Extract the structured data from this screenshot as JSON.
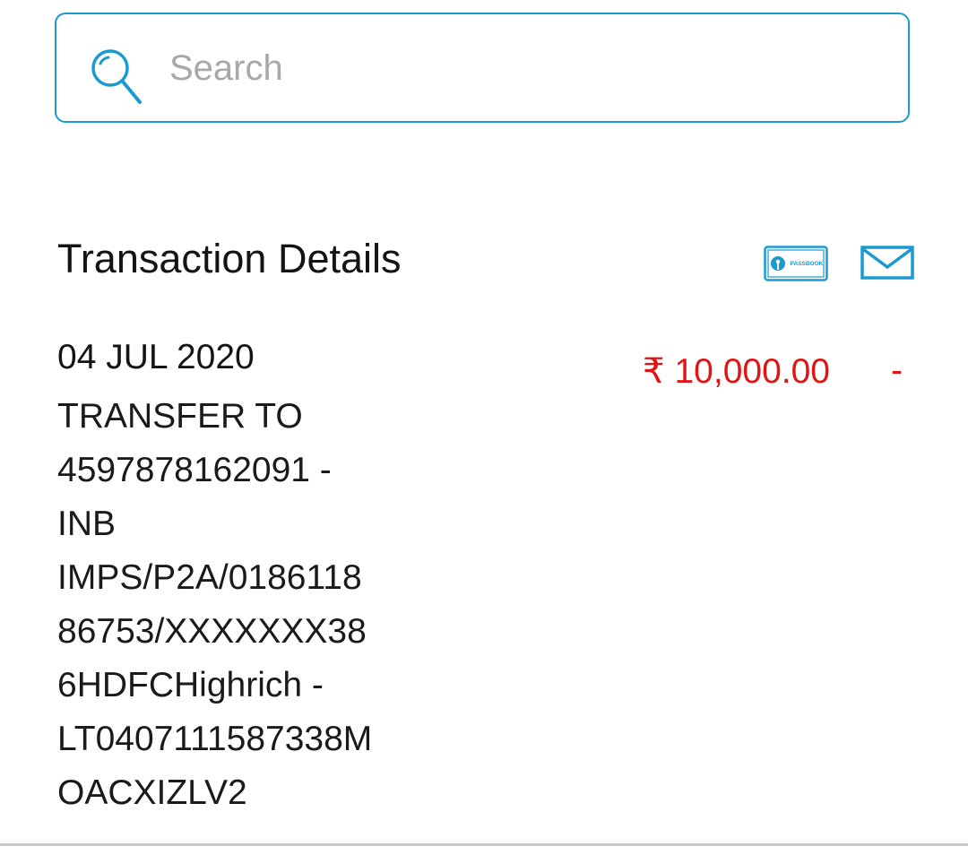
{
  "search": {
    "placeholder": "Search",
    "value": ""
  },
  "section": {
    "title": "Transaction Details",
    "actions": {
      "passbook_icon": "passbook-icon",
      "passbook_label": "PASSBOOK",
      "mail_icon": "mail-icon"
    }
  },
  "transaction": {
    "date": "04 JUL 2020",
    "description_lines": [
      "TRANSFER TO",
      "4597878162091 -",
      "INB",
      "IMPS/P2A/0186118",
      "86753/XXXXXXX38",
      "6HDFCHighrich -",
      "LT0407111587338M",
      "OACXIZLV2"
    ],
    "amount": "₹ 10,000.00",
    "sign": "-"
  },
  "colors": {
    "accent": "#1a9ad1",
    "debit": "#e01515",
    "placeholder": "#a8a8a8",
    "divider": "#c9c9c9"
  }
}
